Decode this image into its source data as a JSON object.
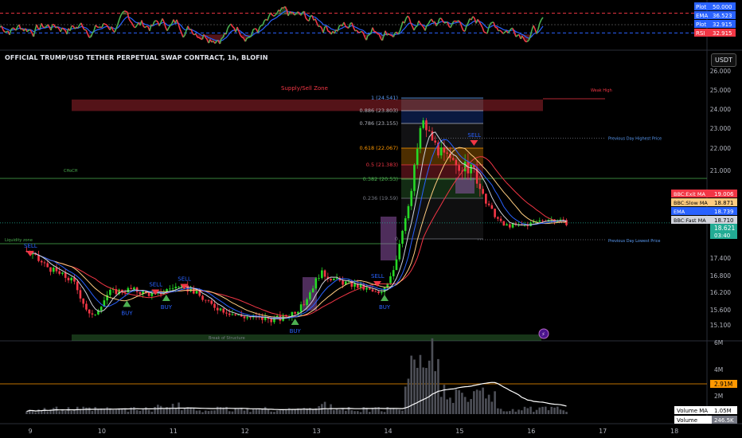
{
  "title": "OFFICIAL TRUMP/USD TETHER PERPETUAL SWAP CONTRACT, 1h, BLOFIN",
  "currency_button": "USDT",
  "rsi_panel": {
    "tags": [
      {
        "label": "Plot",
        "value": "50.000",
        "color": "#2962ff"
      },
      {
        "label": "EMA",
        "value": "36.523",
        "color": "#2962ff"
      },
      {
        "label": "Plot",
        "value": "32.915",
        "color": "#2962ff"
      },
      {
        "label": "RSI",
        "value": "32.915",
        "color": "#f23645"
      }
    ],
    "levels": [
      70,
      50,
      30
    ]
  },
  "price_axis": [
    "26.000",
    "25.000",
    "24.000",
    "23.000",
    "22.000",
    "21.000",
    "18.000",
    "17.400",
    "16.800",
    "16.200",
    "15.600",
    "15.100"
  ],
  "ma_tags": [
    {
      "label": "BBC:Exit MA",
      "value": "19.006",
      "bg": "#f23645",
      "fg": "#ffffff"
    },
    {
      "label": "BBC:Slow MA",
      "value": "18.871",
      "bg": "#ffcc80",
      "fg": "#000000"
    },
    {
      "label": "EMA",
      "value": "18.739",
      "bg": "#2962ff",
      "fg": "#ffffff"
    },
    {
      "label": "BBC:Fast MA",
      "value": "18.710",
      "bg": "#d1d4dc",
      "fg": "#000000"
    }
  ],
  "last_price": {
    "value": "18.621",
    "countdown": "03:40",
    "color": "#22ab94"
  },
  "volume_axis": [
    "6M",
    "4M",
    "2M"
  ],
  "volume_level_tag": "2.91M",
  "volume_tags": [
    {
      "label": "Volume MA",
      "value": "1.05M"
    },
    {
      "label": "Volume",
      "value": "246.5K"
    }
  ],
  "x_axis": [
    "9",
    "10",
    "11",
    "12",
    "13",
    "14",
    "15",
    "16",
    "17",
    "18"
  ],
  "annotations": {
    "supply_zone": "Supply/Sell Zone",
    "weak_high": "Weak High",
    "prev_day_high": "Previous Day Highest Price",
    "prev_day_low": "Previous Day Lowest Price",
    "choch": "CHoCH",
    "liquidity": "Liquidity zone",
    "break_structure": "Break of Structure"
  },
  "fib_levels": [
    {
      "label": "1 (24.541)",
      "color": "#5b9cf6"
    },
    {
      "label": "0.886 (23.803)",
      "color": "#b2b5be"
    },
    {
      "label": "0.786 (23.155)",
      "color": "#b2b5be"
    },
    {
      "label": "0.618 (22.067)",
      "color": "#ff9800"
    },
    {
      "label": "0.5 (21.383)",
      "color": "#f23645"
    },
    {
      "label": "0.382 (20.53)",
      "color": "#4caf50"
    },
    {
      "label": "0.236 (19.59)",
      "color": "#787b86"
    },
    {
      "label": "0",
      "color": "#787b86"
    }
  ],
  "signals": {
    "sell": "SELL",
    "buy": "BUY"
  },
  "colors": {
    "up": "#26d926",
    "down": "#f23645",
    "ema": "#2962ff",
    "exit_ma": "#f23645",
    "slow_ma": "#ffcc80",
    "fast_ma": "#d1d4dc",
    "rsi_up": "#4caf50",
    "rsi_down": "#f23645"
  },
  "chart_data": {
    "type": "candlestick",
    "title": "OFFICIAL TRUMP/USD TETHER PERPETUAL SWAP CONTRACT, 1h, BLOFIN",
    "xlabel": "",
    "ylabel": "",
    "x_ticks": [
      "9",
      "10",
      "11",
      "12",
      "13",
      "14",
      "15",
      "16",
      "17",
      "18"
    ],
    "ylim": [
      14.9,
      26.6
    ],
    "close_path": [
      {
        "day": 8.95,
        "price": 17.6
      },
      {
        "day": 9.3,
        "price": 17.0
      },
      {
        "day": 9.6,
        "price": 16.6
      },
      {
        "day": 9.85,
        "price": 15.3
      },
      {
        "day": 10.1,
        "price": 16.2
      },
      {
        "day": 10.4,
        "price": 16.3
      },
      {
        "day": 10.75,
        "price": 16.1
      },
      {
        "day": 11.0,
        "price": 16.4
      },
      {
        "day": 11.25,
        "price": 16.3
      },
      {
        "day": 11.5,
        "price": 15.8
      },
      {
        "day": 11.9,
        "price": 15.4
      },
      {
        "day": 12.3,
        "price": 15.3
      },
      {
        "day": 12.5,
        "price": 15.3
      },
      {
        "day": 12.8,
        "price": 15.7
      },
      {
        "day": 13.05,
        "price": 16.9
      },
      {
        "day": 13.3,
        "price": 16.6
      },
      {
        "day": 13.6,
        "price": 16.4
      },
      {
        "day": 13.9,
        "price": 16.1
      },
      {
        "day": 14.1,
        "price": 17.2
      },
      {
        "day": 14.3,
        "price": 19.5
      },
      {
        "day": 14.47,
        "price": 23.4
      },
      {
        "day": 14.7,
        "price": 21.9
      },
      {
        "day": 14.9,
        "price": 21.3
      },
      {
        "day": 15.2,
        "price": 21.0
      },
      {
        "day": 15.35,
        "price": 19.6
      },
      {
        "day": 15.6,
        "price": 18.5
      },
      {
        "day": 15.9,
        "price": 18.5
      },
      {
        "day": 16.2,
        "price": 18.8
      },
      {
        "day": 16.5,
        "price": 18.62
      }
    ],
    "volume_ylim": [
      0,
      6000000
    ],
    "volume_ma_last": 1050000,
    "volume_last": 246500,
    "rsi_last": 32.915,
    "rsi_ema_last": 36.523,
    "ma_last": {
      "exit_ma": 19.006,
      "slow_ma": 18.871,
      "ema": 18.739,
      "fast_ma": 18.71
    },
    "last_price": 18.621
  }
}
